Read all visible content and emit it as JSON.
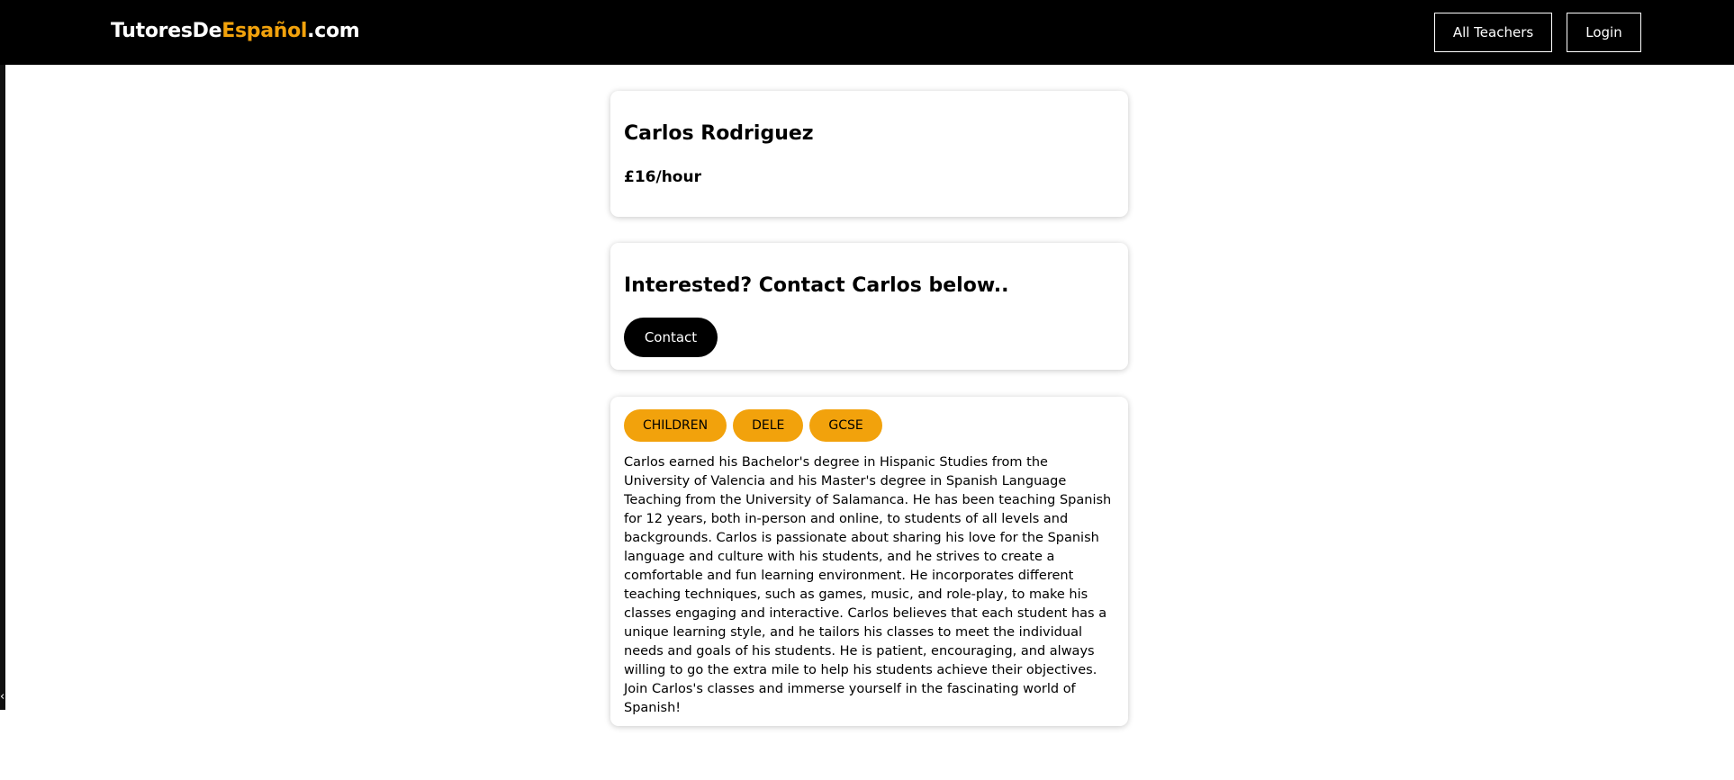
{
  "header": {
    "logo": {
      "part1": "TutoresDe",
      "part2": "Español",
      "part3": ".com"
    },
    "nav": {
      "all_teachers": "All Teachers",
      "login": "Login"
    }
  },
  "sidebar_edge": {
    "arrow_glyph": "‹"
  },
  "profile": {
    "name": "Carlos Rodriguez",
    "rate": "£16/hour"
  },
  "contact": {
    "heading": "Interested? Contact Carlos below..",
    "button_label": "Contact"
  },
  "about": {
    "tags": [
      "CHILDREN",
      "DELE",
      "GCSE"
    ],
    "bio": "Carlos earned his Bachelor's degree in Hispanic Studies from the University of Valencia and his Master's degree in Spanish Language Teaching from the University of Salamanca. He has been teaching Spanish for 12 years, both in-person and online, to students of all levels and backgrounds. Carlos is passionate about sharing his love for the Spanish language and culture with his students, and he strives to create a comfortable and fun learning environment. He incorporates different teaching techniques, such as games, music, and role-play, to make his classes engaging and interactive. Carlos believes that each student has a unique learning style, and he tailors his classes to meet the individual needs and goals of his students. He is patient, encouraging, and always willing to go the extra mile to help his students achieve their objectives. Join Carlos's classes and immerse yourself in the fascinating world of Spanish!"
  },
  "colors": {
    "accent": "#f2a20c",
    "header_bg": "#000000",
    "page_bg": "#ffffff"
  }
}
